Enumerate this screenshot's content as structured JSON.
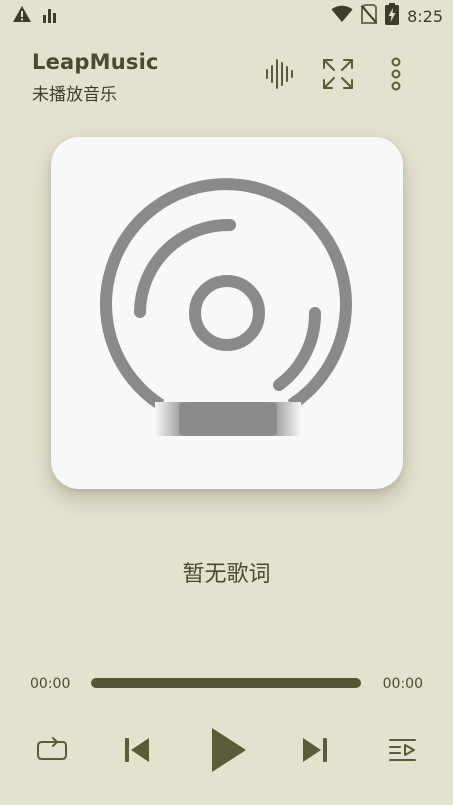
{
  "status_bar": {
    "time": "8:25",
    "left_icons": [
      "warning-icon",
      "signal-bars-icon"
    ],
    "right_icons": [
      "wifi-icon",
      "no-sim-icon",
      "battery-charging-icon"
    ]
  },
  "header": {
    "title": "LeapMusic",
    "subtitle": "未播放音乐",
    "actions": [
      "waveform-icon",
      "fullscreen-icon",
      "more-vertical-icon"
    ]
  },
  "cover": {
    "icon": "disc-placeholder-icon"
  },
  "lyrics": {
    "text": "暂无歌词"
  },
  "player": {
    "current_time": "00:00",
    "total_time": "00:00",
    "progress": 0,
    "controls": [
      "repeat-icon",
      "previous-icon",
      "play-icon",
      "next-icon",
      "playlist-icon"
    ]
  },
  "colors": {
    "background": "#e4e2cf",
    "accent": "#5b5a39",
    "cover_background": "#f7f8f8",
    "disc_gray": "#8a8a8a"
  }
}
